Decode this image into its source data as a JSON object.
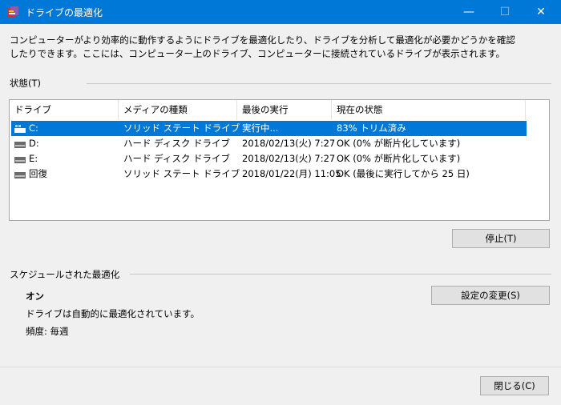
{
  "window": {
    "title": "ドライブの最適化",
    "minimize_glyph": "—",
    "maximize_glyph": "☐",
    "close_glyph": "✕"
  },
  "description": "コンピューターがより効率的に動作するようにドライブを最適化したり、ドライブを分析して最適化が必要かどうかを確認したりできます。ここには、コンピューター上のドライブ、コンピューターに接続されているドライブが表示されます。",
  "status_section": {
    "label": "状態(T)",
    "columns": [
      "ドライブ",
      "メディアの種類",
      "最後の実行",
      "現在の状態"
    ],
    "rows": [
      {
        "drive": "C:",
        "media": "ソリッド ステート ドライブ",
        "last_run": "実行中...",
        "status": "83% トリム済み",
        "selected": true,
        "icon": "windows-drive-icon"
      },
      {
        "drive": "D:",
        "media": "ハード ディスク ドライブ",
        "last_run": "2018/02/13(火) 7:27",
        "status": "OK (0% が断片化しています)",
        "selected": false,
        "icon": "drive-icon"
      },
      {
        "drive": "E:",
        "media": "ハード ディスク ドライブ",
        "last_run": "2018/02/13(火) 7:27",
        "status": "OK (0% が断片化しています)",
        "selected": false,
        "icon": "drive-icon"
      },
      {
        "drive": "回復",
        "media": "ソリッド ステート ドライブ",
        "last_run": "2018/01/22(月) 11:05",
        "status": "OK (最後に実行してから 25 日)",
        "selected": false,
        "icon": "drive-icon"
      }
    ],
    "stop_button": "停止(T)"
  },
  "schedule_section": {
    "label": "スケジュールされた最適化",
    "state": "オン",
    "auto_text": "ドライブは自動的に最適化されています。",
    "frequency": "頻度: 毎週",
    "change_settings_button": "設定の変更(S)"
  },
  "footer": {
    "close_button": "閉じる(C)"
  },
  "colors": {
    "titlebar": "#0078d7",
    "selection": "#0078d7"
  }
}
